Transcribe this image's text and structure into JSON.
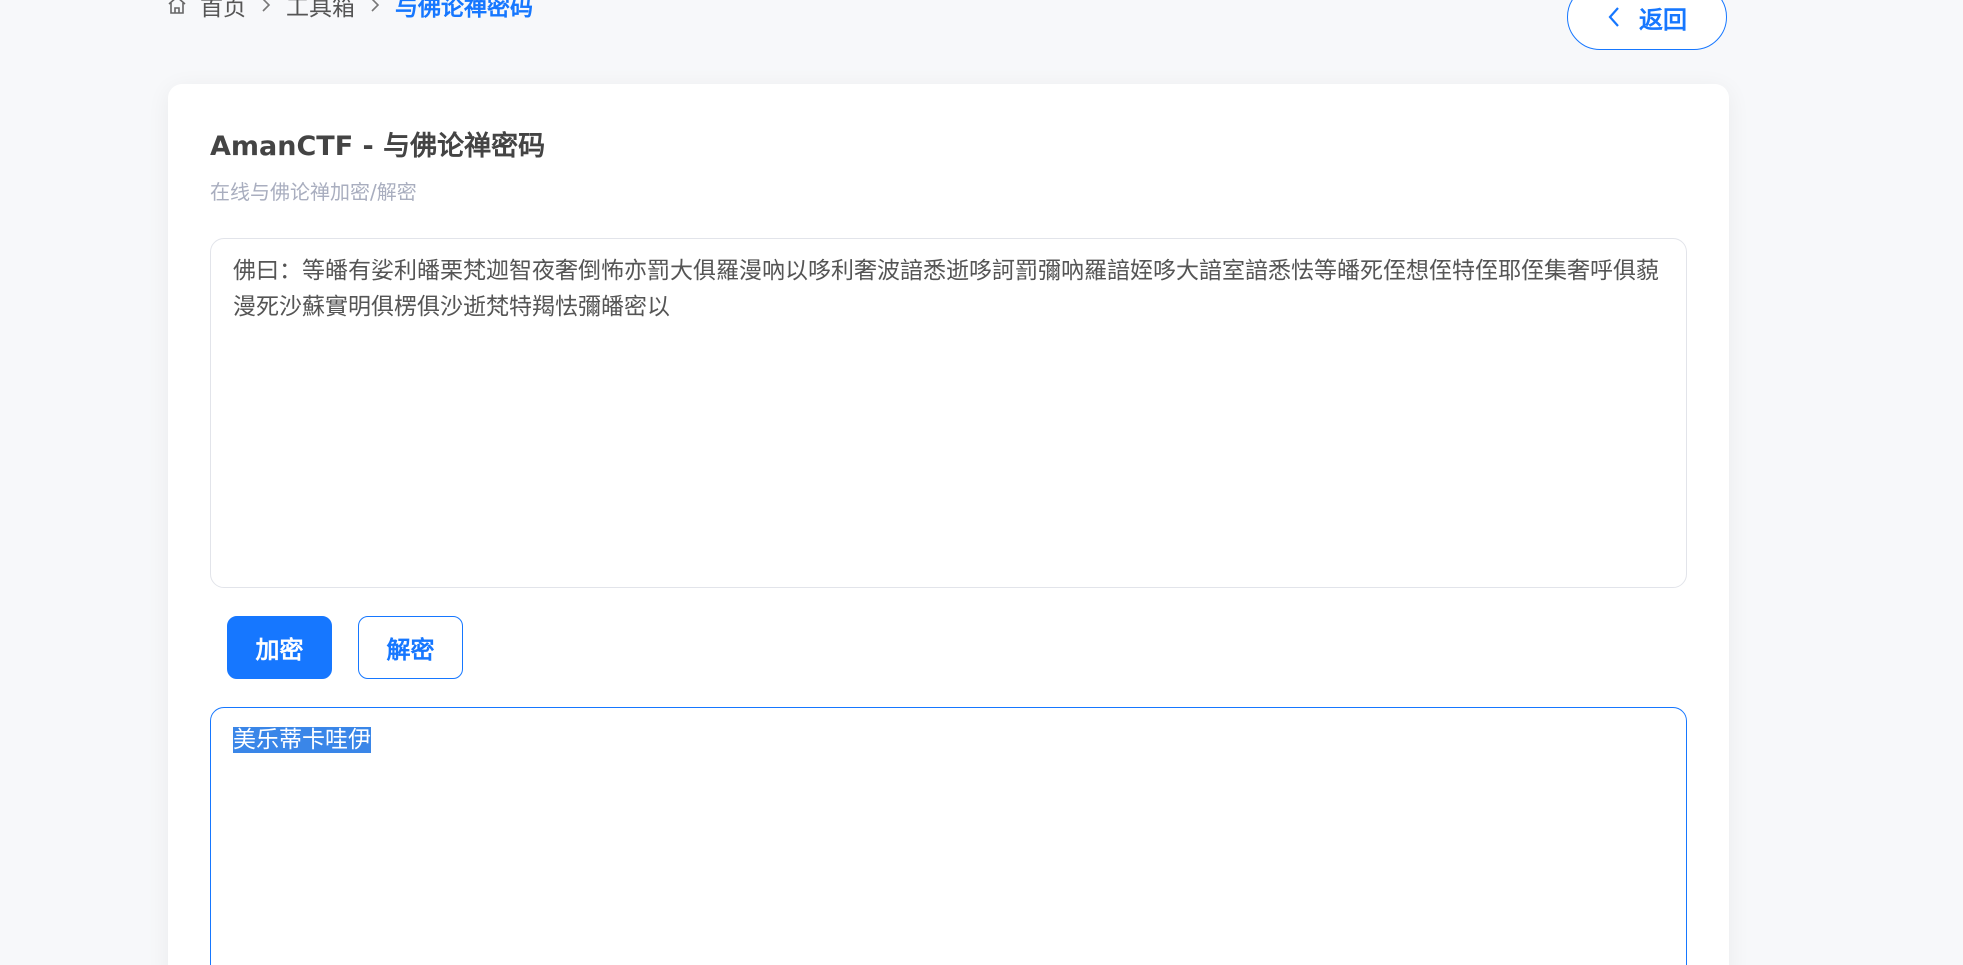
{
  "breadcrumb": {
    "home_label": "首页",
    "toolbox_label": "工具箱",
    "current_label": "与佛论禅密码"
  },
  "back_button": {
    "label": "返回"
  },
  "card": {
    "title": "AmanCTF - 与佛论禅密码",
    "subtitle": "在线与佛论禅加密/解密"
  },
  "input": {
    "value": "佛曰：等皤有娑利皤栗梵迦智夜奢倒怖亦罰大俱羅漫吶以哆利奢波諳悉逝哆訶罰彌吶羅諳姪哆大諳室諳悉怯等皤死侄想侄特侄耶侄集奢呼俱藐漫死沙蘇實明俱楞俱沙逝梵特羯怯彌皤密以"
  },
  "actions": {
    "encrypt_label": "加密",
    "decrypt_label": "解密"
  },
  "output": {
    "value": "美乐蒂卡哇伊"
  },
  "colors": {
    "accent": "#1677ff",
    "background": "#f7f8fa",
    "card": "#ffffff",
    "subtitle": "#a9aebf",
    "selection": "#3a86e8"
  },
  "icons": {
    "home": "home-icon",
    "separator": "chevron-right-icon",
    "back": "chevron-left-icon",
    "resize": "resize-handle-icon"
  }
}
